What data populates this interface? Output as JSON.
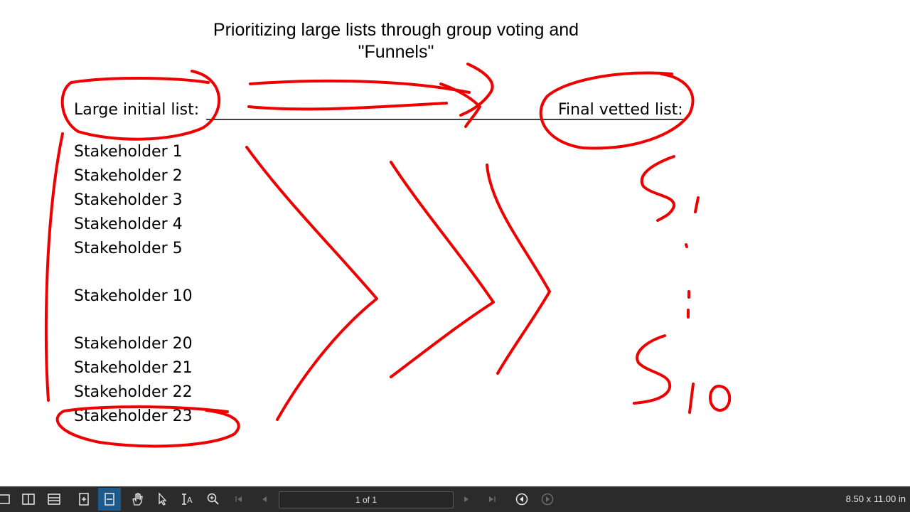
{
  "document": {
    "title_line1": "Prioritizing large lists through group voting and",
    "title_line2": "\"Funnels\"",
    "left_header": "Large initial list:",
    "right_header": "Final vetted list:",
    "list_items": [
      "Stakeholder 1",
      "Stakeholder 2",
      "Stakeholder 3",
      "Stakeholder 4",
      "Stakeholder 5",
      "Stakeholder 10",
      "Stakeholder 20",
      "Stakeholder 21",
      "Stakeholder 22",
      "Stakeholder 23"
    ]
  },
  "annotations": {
    "ink_color": "#ee0000",
    "handwritten_first": "S1",
    "handwritten_last": "S10"
  },
  "toolbar": {
    "page_indicator": "1 of 1",
    "page_size": "8.50 x 11.00 in",
    "background": "#2b2b2b",
    "active_color": "#1c5a8c",
    "icons": [
      "sidebar-icon",
      "single-page-view-icon",
      "continuous-view-icon",
      "fit-page-icon",
      "fit-width-icon",
      "pan-hand-icon",
      "pointer-icon",
      "text-select-icon",
      "zoom-icon",
      "first-page-icon",
      "previous-page-icon",
      "next-page-icon",
      "last-page-icon",
      "go-back-icon",
      "go-forward-icon"
    ]
  }
}
